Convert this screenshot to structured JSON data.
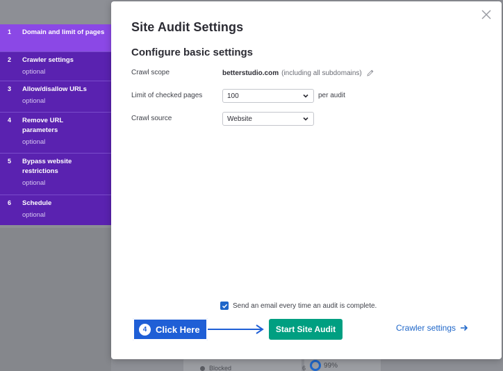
{
  "background": {
    "blocked_label": "Blocked",
    "blocked_count": "6",
    "percent": "99%"
  },
  "modal": {
    "title": "Site Audit Settings",
    "section_title": "Configure basic settings",
    "crawl_scope": {
      "label": "Crawl scope",
      "domain": "betterstudio.com",
      "note": "(including all subdomains)"
    },
    "limit": {
      "label": "Limit of checked pages",
      "value": "100",
      "suffix": "per audit"
    },
    "crawl_source": {
      "label": "Crawl source",
      "value": "Website"
    },
    "email_checkbox": {
      "checked": true,
      "label": "Send an email every time an audit is complete."
    },
    "start_button": "Start Site Audit",
    "next_link": "Crawler settings"
  },
  "callout": {
    "number": "4",
    "text": "Click Here"
  },
  "steps": [
    {
      "num": "1",
      "name": "Domain and limit of pages",
      "sub": ""
    },
    {
      "num": "2",
      "name": "Crawler settings",
      "sub": "optional"
    },
    {
      "num": "3",
      "name": "Allow/disallow URLs",
      "sub": "optional"
    },
    {
      "num": "4",
      "name": "Remove URL parameters",
      "sub": "optional"
    },
    {
      "num": "5",
      "name": "Bypass website restrictions",
      "sub": "optional"
    },
    {
      "num": "6",
      "name": "Schedule",
      "sub": "optional"
    }
  ],
  "colors": {
    "accent_purple": "#5a22b0",
    "active_step": "#8b48e6",
    "primary_green": "#009f81",
    "link_blue": "#1e66c9",
    "callout_blue": "#1f5fd6"
  }
}
